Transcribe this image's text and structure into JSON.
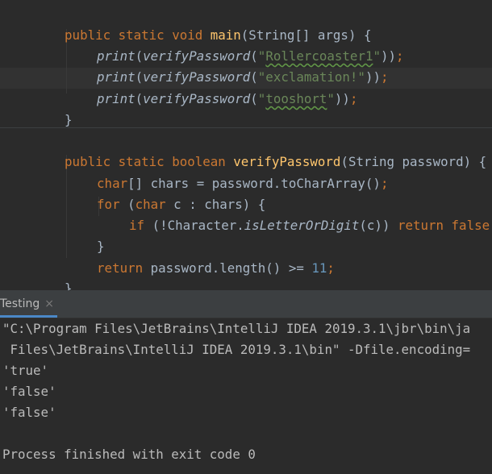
{
  "code": {
    "l1": {
      "t1": "public static void ",
      "t2": "main",
      "t3": "(String[] args) {"
    },
    "l2": {
      "t1": "print",
      "t2": "(",
      "t3": "verifyPassword",
      "t4": "(",
      "t5": "\"",
      "t6": "Rollercoaster1",
      "t7": "\"",
      "t8": "))",
      "t9": ";"
    },
    "l3": {
      "t1": "print",
      "t2": "(",
      "t3": "verifyPassword",
      "t4": "(",
      "t5": "\"exclamation!\"",
      "t6": "))",
      "t7": ";"
    },
    "l4": {
      "t1": "print",
      "t2": "(",
      "t3": "verifyPassword",
      "t4": "(",
      "t5": "\"",
      "t6": "tooshort",
      "t7": "\"",
      "t8": "))",
      "t9": ";"
    },
    "l5": "}",
    "l6": {
      "t1": "public static boolean ",
      "t2": "verifyPassword",
      "t3": "(String password) {"
    },
    "l7": {
      "t1": "char",
      "t2": "[] chars = password.toCharArray()",
      "t3": ";"
    },
    "l8": {
      "t1": "for ",
      "t2": "(",
      "t3": "char ",
      "t4": "c : chars) {"
    },
    "l9": {
      "t1": "if ",
      "t2": "(!Character.",
      "t3": "isLetterOrDigit",
      "t4": "(c)) ",
      "t5": "return false;"
    },
    "l10": "}",
    "l11": {
      "t1": "return ",
      "t2": "password.length() >= ",
      "t3": "11",
      "t4": ";"
    },
    "l12": "}"
  },
  "panel": {
    "tab_label": "Testing",
    "close_glyph": "×",
    "lines": [
      "\"C:\\Program Files\\JetBrains\\IntelliJ IDEA 2019.3.1\\jbr\\bin\\ja",
      " Files\\JetBrains\\IntelliJ IDEA 2019.3.1\\bin\" -Dfile.encoding=",
      "'true'",
      "'false'",
      "'false'",
      "",
      "Process finished with exit code 0"
    ]
  },
  "colors": {
    "keyword": "#cc7832",
    "method_decl": "#ffc66d",
    "string": "#6a8759",
    "number": "#6897bb",
    "text": "#a9b7c6",
    "background": "#2b2b2b"
  }
}
